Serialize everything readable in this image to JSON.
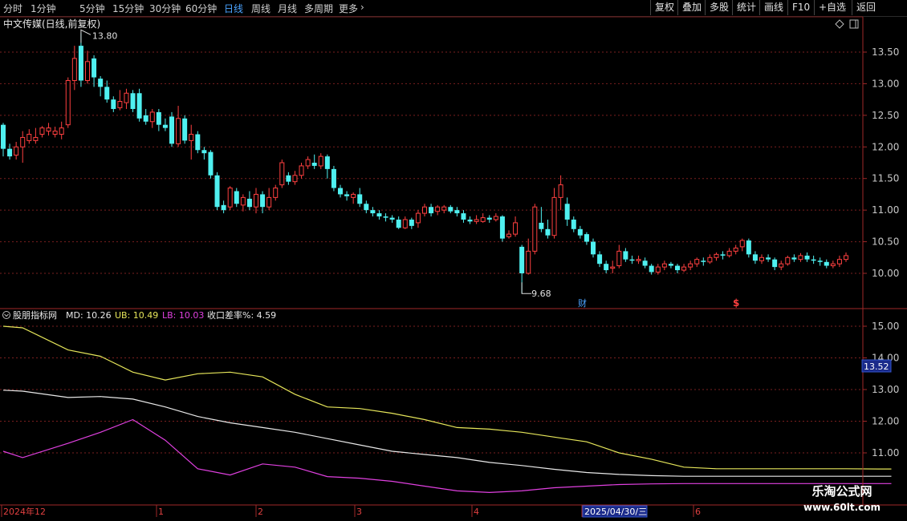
{
  "toolbar": {
    "timeframes": [
      "分时",
      "1分钟",
      "5分钟",
      "15分钟",
      "30分钟",
      "60分钟",
      "日线",
      "周线",
      "月线",
      "多周期",
      "更多"
    ],
    "active": "日线",
    "more_icon": "chevron-right-icon",
    "right_buttons": [
      "复权",
      "叠加",
      "多股",
      "统计",
      "画线",
      "F10",
      "+自选",
      "返回"
    ]
  },
  "main_chart": {
    "title": "中文传媒(日线,前复权)",
    "high_label": "13.80",
    "low_label": "9.68",
    "y_ticks": [
      "13.50",
      "13.00",
      "12.50",
      "12.00",
      "11.50",
      "11.00",
      "10.50",
      "10.00"
    ],
    "marker_cai": "财",
    "marker_s": "$",
    "icons": [
      "diamond-icon",
      "window-toggle-icon"
    ]
  },
  "indicator": {
    "name": "股朋指标网",
    "md_label": "MD: 10.26",
    "ub_label": "UB: 10.49",
    "lb_label": "LB: 10.03",
    "diff_label": "收口差率%: 4.59",
    "y_ticks": [
      "15.00",
      "14.00",
      "13.00",
      "12.00",
      "11.00"
    ],
    "current_value": "13.52"
  },
  "x_axis": {
    "labels": [
      "2024年12",
      "1",
      "2",
      "3",
      "4",
      "2025/04/30/三",
      "6"
    ]
  },
  "watermark": {
    "line1": "乐淘公式网",
    "line2": "www.60lt.com"
  },
  "colors": {
    "up": "#ff4040",
    "down": "#4ff0f0",
    "grid": "#7a1f1f",
    "ub": "#e6e65a",
    "md": "#e8e8e8",
    "lb": "#e040e0",
    "axis_text": "#c8c8c8"
  },
  "chart_data": {
    "type": "candlestick",
    "title": "中文传媒(日线,前复权)",
    "ylim": [
      9.4,
      13.95
    ],
    "candles": [
      [
        12.35,
        11.97,
        12.38,
        11.85
      ],
      [
        11.97,
        11.85,
        12.05,
        11.8
      ],
      [
        11.87,
        12.0,
        12.08,
        11.8
      ],
      [
        12.0,
        12.15,
        12.25,
        11.75
      ],
      [
        12.1,
        12.2,
        12.28,
        12.05
      ],
      [
        12.1,
        12.15,
        12.3,
        12.05
      ],
      [
        12.2,
        12.3,
        12.33,
        12.15
      ],
      [
        12.25,
        12.3,
        12.38,
        12.18
      ],
      [
        12.2,
        12.25,
        12.32,
        12.15
      ],
      [
        12.2,
        12.3,
        12.4,
        12.12
      ],
      [
        12.35,
        13.05,
        13.1,
        12.3
      ],
      [
        13.05,
        13.4,
        13.6,
        12.9
      ],
      [
        13.6,
        13.05,
        13.8,
        12.95
      ],
      [
        13.05,
        13.35,
        13.52,
        13.0
      ],
      [
        13.4,
        13.1,
        13.45,
        12.95
      ],
      [
        13.08,
        12.95,
        13.12,
        12.8
      ],
      [
        12.95,
        12.75,
        13.05,
        12.7
      ],
      [
        12.75,
        12.6,
        12.8,
        12.55
      ],
      [
        12.62,
        12.72,
        12.9,
        12.58
      ],
      [
        12.7,
        12.85,
        12.92,
        12.6
      ],
      [
        12.85,
        12.6,
        12.9,
        12.55
      ],
      [
        12.85,
        12.45,
        12.92,
        12.4
      ],
      [
        12.5,
        12.4,
        12.6,
        12.35
      ],
      [
        12.4,
        12.55,
        12.6,
        12.3
      ],
      [
        12.55,
        12.35,
        12.6,
        12.25
      ],
      [
        12.35,
        12.3,
        12.45,
        12.25
      ],
      [
        12.48,
        12.05,
        12.55,
        12.0
      ],
      [
        12.05,
        12.45,
        12.65,
        12.0
      ],
      [
        12.45,
        12.1,
        12.5,
        12.05
      ],
      [
        12.1,
        12.2,
        12.35,
        11.8
      ],
      [
        12.2,
        11.95,
        12.25,
        11.9
      ],
      [
        11.95,
        11.9,
        12.0,
        11.8
      ],
      [
        11.92,
        11.55,
        11.95,
        11.5
      ],
      [
        11.55,
        11.05,
        11.6,
        11.0
      ],
      [
        11.08,
        11.0,
        11.15,
        10.95
      ],
      [
        11.05,
        11.35,
        11.38,
        11.0
      ],
      [
        11.3,
        11.1,
        11.35,
        11.05
      ],
      [
        11.08,
        11.2,
        11.25,
        10.98
      ],
      [
        11.18,
        11.05,
        11.3,
        11.0
      ],
      [
        11.05,
        11.25,
        11.35,
        10.95
      ],
      [
        11.25,
        11.05,
        11.3,
        10.95
      ],
      [
        11.05,
        11.2,
        11.35,
        11.0
      ],
      [
        11.2,
        11.35,
        11.4,
        11.15
      ],
      [
        11.4,
        11.75,
        11.8,
        11.35
      ],
      [
        11.55,
        11.45,
        11.6,
        11.4
      ],
      [
        11.45,
        11.55,
        11.62,
        11.4
      ],
      [
        11.55,
        11.7,
        11.75,
        11.5
      ],
      [
        11.7,
        11.8,
        11.85,
        11.65
      ],
      [
        11.75,
        11.7,
        11.88,
        11.65
      ],
      [
        11.7,
        11.85,
        11.9,
        11.65
      ],
      [
        11.85,
        11.65,
        11.88,
        11.5
      ],
      [
        11.65,
        11.35,
        11.7,
        11.3
      ],
      [
        11.35,
        11.25,
        11.4,
        11.2
      ],
      [
        11.25,
        11.22,
        11.3,
        11.15
      ],
      [
        11.2,
        11.25,
        11.28,
        11.1
      ],
      [
        11.25,
        11.1,
        11.35,
        11.05
      ],
      [
        11.1,
        11.0,
        11.15,
        10.95
      ],
      [
        11.0,
        10.95,
        11.05,
        10.9
      ],
      [
        10.95,
        10.9,
        11.0,
        10.85
      ],
      [
        10.9,
        10.88,
        10.95,
        10.82
      ],
      [
        10.88,
        10.85,
        10.92,
        10.8
      ],
      [
        10.85,
        10.72,
        10.9,
        10.7
      ],
      [
        10.72,
        10.85,
        10.9,
        10.7
      ],
      [
        10.85,
        10.75,
        10.88,
        10.7
      ],
      [
        10.8,
        10.95,
        11.0,
        10.72
      ],
      [
        10.95,
        11.05,
        11.1,
        10.9
      ],
      [
        11.05,
        10.95,
        11.1,
        10.9
      ],
      [
        10.98,
        11.05,
        11.08,
        10.92
      ],
      [
        11.0,
        11.05,
        11.08,
        10.95
      ],
      [
        11.05,
        10.98,
        11.08,
        10.95
      ],
      [
        11.0,
        10.95,
        11.05,
        10.9
      ],
      [
        10.95,
        10.85,
        11.0,
        10.8
      ],
      [
        10.85,
        10.82,
        10.9,
        10.78
      ],
      [
        10.82,
        10.85,
        10.92,
        10.78
      ],
      [
        10.82,
        10.88,
        10.95,
        10.8
      ],
      [
        10.88,
        10.85,
        10.92,
        10.8
      ],
      [
        10.85,
        10.9,
        10.95,
        10.82
      ],
      [
        10.9,
        10.55,
        10.92,
        10.5
      ],
      [
        10.58,
        10.62,
        10.68,
        10.55
      ],
      [
        10.62,
        10.8,
        10.9,
        10.58
      ],
      [
        10.42,
        10.0,
        10.45,
        9.68
      ],
      [
        10.0,
        10.35,
        10.55,
        9.98
      ],
      [
        10.35,
        11.05,
        11.1,
        10.3
      ],
      [
        10.8,
        10.7,
        11.05,
        10.65
      ],
      [
        10.7,
        10.6,
        10.85,
        10.55
      ],
      [
        10.6,
        11.2,
        11.35,
        10.55
      ],
      [
        11.2,
        11.4,
        11.55,
        11.0
      ],
      [
        11.1,
        10.85,
        11.2,
        10.75
      ],
      [
        10.85,
        10.7,
        10.9,
        10.65
      ],
      [
        10.7,
        10.6,
        10.75,
        10.55
      ],
      [
        10.62,
        10.5,
        10.65,
        10.45
      ],
      [
        10.5,
        10.3,
        10.55,
        10.25
      ],
      [
        10.3,
        10.15,
        10.35,
        10.1
      ],
      [
        10.15,
        10.05,
        10.2,
        10.0
      ],
      [
        10.08,
        10.1,
        10.2,
        10.0
      ],
      [
        10.12,
        10.35,
        10.45,
        10.08
      ],
      [
        10.35,
        10.22,
        10.4,
        10.18
      ],
      [
        10.22,
        10.2,
        10.28,
        10.15
      ],
      [
        10.2,
        10.22,
        10.28,
        10.15
      ],
      [
        10.2,
        10.12,
        10.25,
        10.08
      ],
      [
        10.12,
        10.02,
        10.15,
        9.98
      ],
      [
        10.02,
        10.1,
        10.15,
        9.98
      ],
      [
        10.1,
        10.15,
        10.2,
        10.05
      ],
      [
        10.15,
        10.12,
        10.18,
        10.08
      ],
      [
        10.12,
        10.05,
        10.15,
        10.0
      ],
      [
        10.05,
        10.1,
        10.15,
        10.02
      ],
      [
        10.1,
        10.15,
        10.2,
        10.05
      ],
      [
        10.15,
        10.22,
        10.25,
        10.1
      ],
      [
        10.2,
        10.18,
        10.25,
        10.12
      ],
      [
        10.18,
        10.25,
        10.3,
        10.15
      ],
      [
        10.25,
        10.3,
        10.33,
        10.2
      ],
      [
        10.3,
        10.28,
        10.35,
        10.22
      ],
      [
        10.28,
        10.35,
        10.4,
        10.25
      ],
      [
        10.35,
        10.4,
        10.45,
        10.3
      ],
      [
        10.42,
        10.52,
        10.55,
        10.35
      ],
      [
        10.52,
        10.3,
        10.55,
        10.25
      ],
      [
        10.3,
        10.2,
        10.35,
        10.15
      ],
      [
        10.2,
        10.25,
        10.3,
        10.15
      ],
      [
        10.25,
        10.22,
        10.3,
        10.18
      ],
      [
        10.22,
        10.1,
        10.25,
        10.05
      ],
      [
        10.1,
        10.15,
        10.2,
        10.05
      ],
      [
        10.15,
        10.25,
        10.28,
        10.12
      ],
      [
        10.25,
        10.22,
        10.3,
        10.18
      ],
      [
        10.22,
        10.28,
        10.32,
        10.18
      ],
      [
        10.28,
        10.22,
        10.33,
        10.18
      ],
      [
        10.22,
        10.2,
        10.28,
        10.15
      ],
      [
        10.2,
        10.18,
        10.25,
        10.12
      ],
      [
        10.18,
        10.12,
        10.22,
        10.08
      ],
      [
        10.12,
        10.15,
        10.2,
        10.08
      ],
      [
        10.15,
        10.22,
        10.28,
        10.1
      ],
      [
        10.22,
        10.28,
        10.33,
        10.18
      ]
    ],
    "indicator": {
      "ylim": [
        10.15,
        15.45
      ],
      "x": [
        0,
        3,
        10,
        15,
        20,
        25,
        30,
        35,
        40,
        45,
        50,
        55,
        60,
        65,
        70,
        75,
        80,
        85,
        90,
        95,
        100,
        105,
        110,
        115,
        120,
        125,
        130,
        135,
        137
      ],
      "ub": [
        15.0,
        14.95,
        14.25,
        14.05,
        13.55,
        13.3,
        13.5,
        13.55,
        13.4,
        12.85,
        12.45,
        12.4,
        12.25,
        12.05,
        11.8,
        11.75,
        11.65,
        11.5,
        11.35,
        11.0,
        10.8,
        10.55,
        10.5,
        10.5,
        10.5,
        10.5,
        10.5,
        10.49,
        10.49
      ],
      "md": [
        12.98,
        12.95,
        12.75,
        12.78,
        12.7,
        12.45,
        12.15,
        11.95,
        11.8,
        11.65,
        11.45,
        11.25,
        11.05,
        10.95,
        10.85,
        10.7,
        10.6,
        10.48,
        10.38,
        10.32,
        10.28,
        10.26,
        10.26,
        10.26,
        10.26,
        10.26,
        10.26,
        10.26,
        10.26
      ],
      "lb": [
        11.05,
        10.85,
        11.3,
        11.65,
        12.05,
        11.4,
        10.5,
        10.3,
        10.65,
        10.55,
        10.25,
        10.2,
        10.1,
        9.95,
        9.8,
        9.75,
        9.8,
        9.9,
        9.95,
        10.0,
        10.02,
        10.03,
        10.03,
        10.03,
        10.03,
        10.03,
        10.03,
        10.03,
        10.03
      ]
    }
  }
}
